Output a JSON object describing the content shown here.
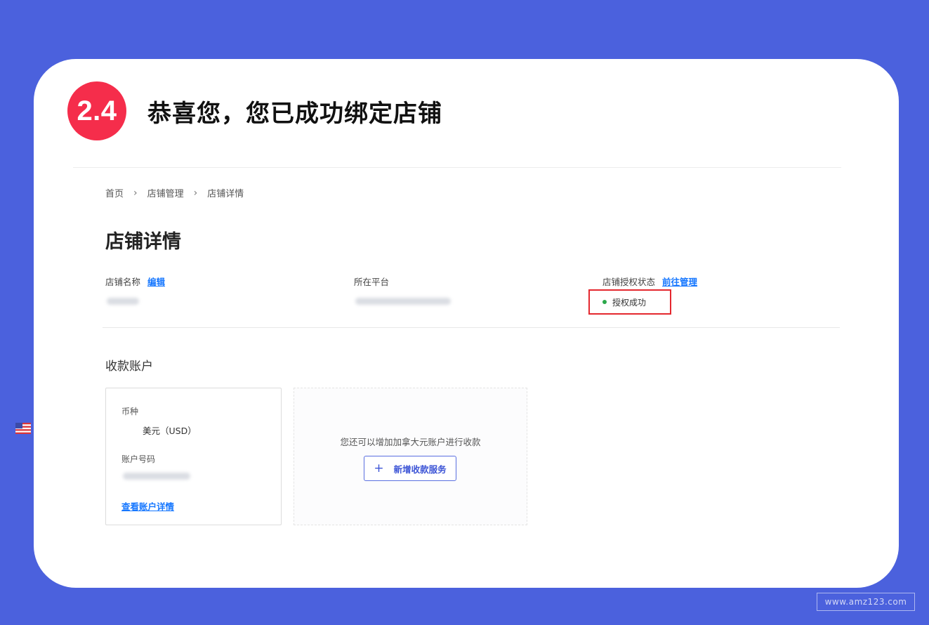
{
  "step": {
    "number": "2.4",
    "title": "恭喜您，您已成功绑定店铺"
  },
  "breadcrumb": {
    "items": [
      "首页",
      "店铺管理",
      "店铺详情"
    ],
    "separator": "›"
  },
  "page_title": "店铺详情",
  "fields": {
    "store_name": {
      "label": "店铺名称",
      "link": "编辑"
    },
    "platform": {
      "label": "所在平台"
    },
    "auth_status": {
      "label": "店铺授权状态",
      "link": "前往管理",
      "value": "授权成功",
      "status_color": "#2ba84a"
    }
  },
  "payment": {
    "section_title": "收款账户",
    "card": {
      "currency_label": "币种",
      "currency_value": "美元（USD）",
      "account_number_label": "账户号码",
      "details_link": "查看账户详情"
    },
    "add": {
      "hint": "您还可以增加加拿大元账户进行收款",
      "button_label": "新增收款服务"
    }
  },
  "watermark": "www.amz123.com",
  "colors": {
    "background": "#4b61dd",
    "badge": "#f52d4b",
    "link": "#1677ff",
    "highlight_box": "#e4282f"
  }
}
